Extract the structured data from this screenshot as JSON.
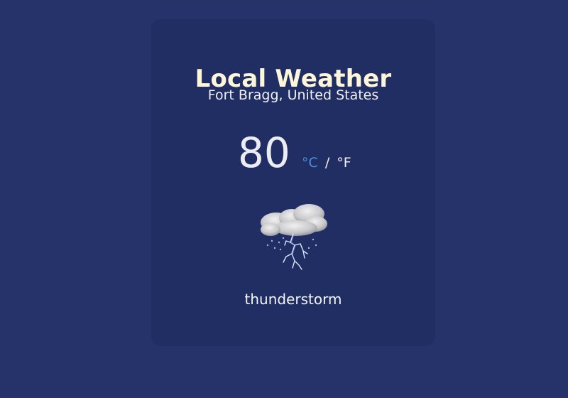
{
  "app": {
    "title": "Local Weather",
    "location": "Fort Bragg, United States"
  },
  "weather": {
    "temperature": "80",
    "unit_celsius": "°C",
    "unit_separator": "/",
    "unit_fahrenheit": "°F",
    "condition": "thunderstorm",
    "icon": "thunderstorm-icon"
  },
  "colors": {
    "background": "#25336a",
    "card": "#212e63",
    "title": "#fdf6da",
    "active_unit": "#4a90e2"
  }
}
